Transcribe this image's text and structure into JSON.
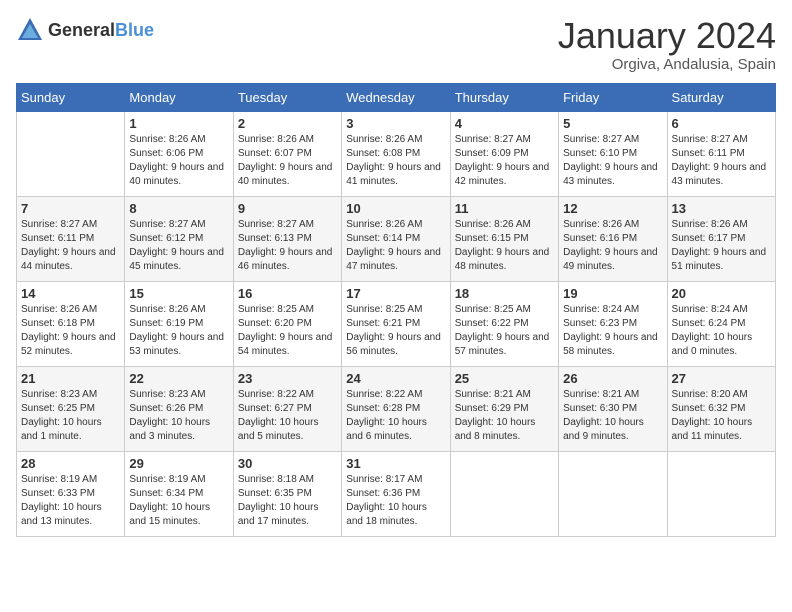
{
  "logo": {
    "text_general": "General",
    "text_blue": "Blue"
  },
  "header": {
    "month": "January 2024",
    "location": "Orgiva, Andalusia, Spain"
  },
  "weekdays": [
    "Sunday",
    "Monday",
    "Tuesday",
    "Wednesday",
    "Thursday",
    "Friday",
    "Saturday"
  ],
  "weeks": [
    [
      {
        "day": "",
        "sunrise": "",
        "sunset": "",
        "daylight": ""
      },
      {
        "day": "1",
        "sunrise": "Sunrise: 8:26 AM",
        "sunset": "Sunset: 6:06 PM",
        "daylight": "Daylight: 9 hours and 40 minutes."
      },
      {
        "day": "2",
        "sunrise": "Sunrise: 8:26 AM",
        "sunset": "Sunset: 6:07 PM",
        "daylight": "Daylight: 9 hours and 40 minutes."
      },
      {
        "day": "3",
        "sunrise": "Sunrise: 8:26 AM",
        "sunset": "Sunset: 6:08 PM",
        "daylight": "Daylight: 9 hours and 41 minutes."
      },
      {
        "day": "4",
        "sunrise": "Sunrise: 8:27 AM",
        "sunset": "Sunset: 6:09 PM",
        "daylight": "Daylight: 9 hours and 42 minutes."
      },
      {
        "day": "5",
        "sunrise": "Sunrise: 8:27 AM",
        "sunset": "Sunset: 6:10 PM",
        "daylight": "Daylight: 9 hours and 43 minutes."
      },
      {
        "day": "6",
        "sunrise": "Sunrise: 8:27 AM",
        "sunset": "Sunset: 6:11 PM",
        "daylight": "Daylight: 9 hours and 43 minutes."
      }
    ],
    [
      {
        "day": "7",
        "sunrise": "Sunrise: 8:27 AM",
        "sunset": "Sunset: 6:11 PM",
        "daylight": "Daylight: 9 hours and 44 minutes."
      },
      {
        "day": "8",
        "sunrise": "Sunrise: 8:27 AM",
        "sunset": "Sunset: 6:12 PM",
        "daylight": "Daylight: 9 hours and 45 minutes."
      },
      {
        "day": "9",
        "sunrise": "Sunrise: 8:27 AM",
        "sunset": "Sunset: 6:13 PM",
        "daylight": "Daylight: 9 hours and 46 minutes."
      },
      {
        "day": "10",
        "sunrise": "Sunrise: 8:26 AM",
        "sunset": "Sunset: 6:14 PM",
        "daylight": "Daylight: 9 hours and 47 minutes."
      },
      {
        "day": "11",
        "sunrise": "Sunrise: 8:26 AM",
        "sunset": "Sunset: 6:15 PM",
        "daylight": "Daylight: 9 hours and 48 minutes."
      },
      {
        "day": "12",
        "sunrise": "Sunrise: 8:26 AM",
        "sunset": "Sunset: 6:16 PM",
        "daylight": "Daylight: 9 hours and 49 minutes."
      },
      {
        "day": "13",
        "sunrise": "Sunrise: 8:26 AM",
        "sunset": "Sunset: 6:17 PM",
        "daylight": "Daylight: 9 hours and 51 minutes."
      }
    ],
    [
      {
        "day": "14",
        "sunrise": "Sunrise: 8:26 AM",
        "sunset": "Sunset: 6:18 PM",
        "daylight": "Daylight: 9 hours and 52 minutes."
      },
      {
        "day": "15",
        "sunrise": "Sunrise: 8:26 AM",
        "sunset": "Sunset: 6:19 PM",
        "daylight": "Daylight: 9 hours and 53 minutes."
      },
      {
        "day": "16",
        "sunrise": "Sunrise: 8:25 AM",
        "sunset": "Sunset: 6:20 PM",
        "daylight": "Daylight: 9 hours and 54 minutes."
      },
      {
        "day": "17",
        "sunrise": "Sunrise: 8:25 AM",
        "sunset": "Sunset: 6:21 PM",
        "daylight": "Daylight: 9 hours and 56 minutes."
      },
      {
        "day": "18",
        "sunrise": "Sunrise: 8:25 AM",
        "sunset": "Sunset: 6:22 PM",
        "daylight": "Daylight: 9 hours and 57 minutes."
      },
      {
        "day": "19",
        "sunrise": "Sunrise: 8:24 AM",
        "sunset": "Sunset: 6:23 PM",
        "daylight": "Daylight: 9 hours and 58 minutes."
      },
      {
        "day": "20",
        "sunrise": "Sunrise: 8:24 AM",
        "sunset": "Sunset: 6:24 PM",
        "daylight": "Daylight: 10 hours and 0 minutes."
      }
    ],
    [
      {
        "day": "21",
        "sunrise": "Sunrise: 8:23 AM",
        "sunset": "Sunset: 6:25 PM",
        "daylight": "Daylight: 10 hours and 1 minute."
      },
      {
        "day": "22",
        "sunrise": "Sunrise: 8:23 AM",
        "sunset": "Sunset: 6:26 PM",
        "daylight": "Daylight: 10 hours and 3 minutes."
      },
      {
        "day": "23",
        "sunrise": "Sunrise: 8:22 AM",
        "sunset": "Sunset: 6:27 PM",
        "daylight": "Daylight: 10 hours and 5 minutes."
      },
      {
        "day": "24",
        "sunrise": "Sunrise: 8:22 AM",
        "sunset": "Sunset: 6:28 PM",
        "daylight": "Daylight: 10 hours and 6 minutes."
      },
      {
        "day": "25",
        "sunrise": "Sunrise: 8:21 AM",
        "sunset": "Sunset: 6:29 PM",
        "daylight": "Daylight: 10 hours and 8 minutes."
      },
      {
        "day": "26",
        "sunrise": "Sunrise: 8:21 AM",
        "sunset": "Sunset: 6:30 PM",
        "daylight": "Daylight: 10 hours and 9 minutes."
      },
      {
        "day": "27",
        "sunrise": "Sunrise: 8:20 AM",
        "sunset": "Sunset: 6:32 PM",
        "daylight": "Daylight: 10 hours and 11 minutes."
      }
    ],
    [
      {
        "day": "28",
        "sunrise": "Sunrise: 8:19 AM",
        "sunset": "Sunset: 6:33 PM",
        "daylight": "Daylight: 10 hours and 13 minutes."
      },
      {
        "day": "29",
        "sunrise": "Sunrise: 8:19 AM",
        "sunset": "Sunset: 6:34 PM",
        "daylight": "Daylight: 10 hours and 15 minutes."
      },
      {
        "day": "30",
        "sunrise": "Sunrise: 8:18 AM",
        "sunset": "Sunset: 6:35 PM",
        "daylight": "Daylight: 10 hours and 17 minutes."
      },
      {
        "day": "31",
        "sunrise": "Sunrise: 8:17 AM",
        "sunset": "Sunset: 6:36 PM",
        "daylight": "Daylight: 10 hours and 18 minutes."
      },
      {
        "day": "",
        "sunrise": "",
        "sunset": "",
        "daylight": ""
      },
      {
        "day": "",
        "sunrise": "",
        "sunset": "",
        "daylight": ""
      },
      {
        "day": "",
        "sunrise": "",
        "sunset": "",
        "daylight": ""
      }
    ]
  ]
}
